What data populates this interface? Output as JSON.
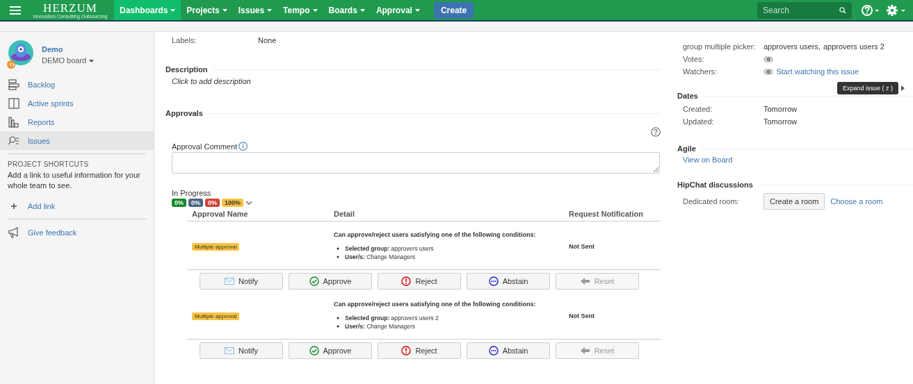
{
  "nav": {
    "logo": "HERZUM",
    "tagline": "Innovation Consulting Outsourcing",
    "items": [
      {
        "label": "Dashboards",
        "selected": true
      },
      {
        "label": "Projects",
        "selected": false
      },
      {
        "label": "Issues",
        "selected": false
      },
      {
        "label": "Tempo",
        "selected": false
      },
      {
        "label": "Boards",
        "selected": false
      },
      {
        "label": "Approval",
        "selected": false
      }
    ],
    "create": "Create",
    "search": {
      "placeholder": "Search"
    }
  },
  "sidebar": {
    "project": {
      "name": "Demo",
      "board": "DEMO board"
    },
    "items": [
      {
        "label": "Backlog",
        "kind": "backlog",
        "selected": false
      },
      {
        "label": "Active sprints",
        "kind": "sprints",
        "selected": false
      },
      {
        "label": "Reports",
        "kind": "reports",
        "selected": false
      },
      {
        "label": "Issues",
        "kind": "issues",
        "selected": true
      }
    ],
    "shortcuts": {
      "heading": "PROJECT SHORTCUTS",
      "text": "Add a link to useful information for your whole team to see.",
      "add_link": "Add link"
    },
    "feedback": "Give feedback"
  },
  "main": {
    "labels": {
      "label": "Labels:",
      "value": "None"
    },
    "description": {
      "heading": "Description",
      "placeholder": "Click to add description"
    },
    "approvals": {
      "heading": "Approvals",
      "comment_label": "Approval Comment",
      "status": "In Progress",
      "badges": [
        {
          "text": "0%",
          "color": "#14892c"
        },
        {
          "text": "0%",
          "color": "#4a6785"
        },
        {
          "text": "0%",
          "color": "#d04437"
        },
        {
          "text": "100%",
          "color": "#f6c342"
        }
      ],
      "columns": [
        "Approval Name",
        "Detail",
        "Request Notification"
      ],
      "rows": [
        {
          "name": "Multiple approval",
          "intro": "Can approve/reject users satisfying one of the following conditions:",
          "conditions": [
            {
              "label": "Selected group:",
              "value": "approvers users"
            },
            {
              "label": "User/s:",
              "value": "Change Managers"
            }
          ],
          "notification": "Not Sent",
          "buttons": [
            {
              "label": "Notify",
              "kind": "notify",
              "disabled": false
            },
            {
              "label": "Approve",
              "kind": "approve",
              "disabled": false
            },
            {
              "label": "Reject",
              "kind": "reject",
              "disabled": false
            },
            {
              "label": "Abstain",
              "kind": "abstain",
              "disabled": false
            },
            {
              "label": "Reset",
              "kind": "reset",
              "disabled": true
            }
          ]
        },
        {
          "name": "Multiple approval",
          "intro": "Can approve/reject users satisfying one of the following conditions:",
          "conditions": [
            {
              "label": "Selected group:",
              "value": "approvers users 2"
            },
            {
              "label": "User/s:",
              "value": "Change Managers"
            }
          ],
          "notification": "Not Sent",
          "buttons": [
            {
              "label": "Notify",
              "kind": "notify",
              "disabled": false
            },
            {
              "label": "Approve",
              "kind": "approve",
              "disabled": false
            },
            {
              "label": "Reject",
              "kind": "reject",
              "disabled": false
            },
            {
              "label": "Abstain",
              "kind": "abstain",
              "disabled": false
            },
            {
              "label": "Reset",
              "kind": "reset",
              "disabled": true
            }
          ]
        }
      ]
    }
  },
  "details": {
    "people": [
      {
        "label": "group multiple picker:",
        "values": [
          "approvers users,",
          "approvers users 2"
        ]
      },
      {
        "label": "Votes:",
        "count": "0"
      },
      {
        "label": "Watchers:",
        "count": "0",
        "link": "Start watching this issue"
      }
    ],
    "tooltip": "Expand issue ( z )",
    "dates": {
      "heading": "Dates",
      "rows": [
        {
          "label": "Created:",
          "value": "Tomorrow"
        },
        {
          "label": "Updated:",
          "value": "Tomorrow"
        }
      ]
    },
    "agile": {
      "heading": "Agile",
      "link": "View on Board"
    },
    "hipchat": {
      "heading": "HipChat discussions",
      "label": "Dedicated room:",
      "button": "Create a room",
      "link": "Choose a room"
    }
  }
}
